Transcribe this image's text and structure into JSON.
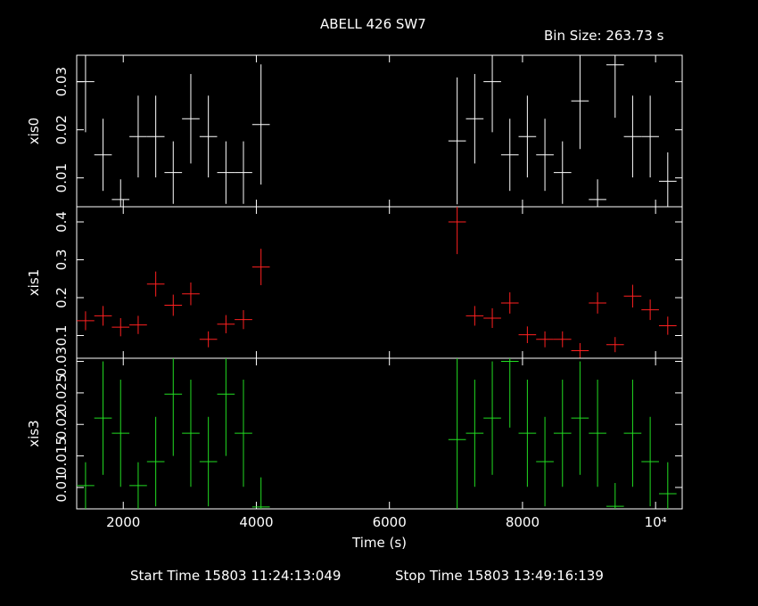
{
  "title": "ABELL 426 SW7",
  "bin_size": "Bin Size: 263.73 s",
  "start_time": "Start Time 15803 11:24:13:049",
  "stop_time": "Stop Time 15803 13:49:16:139",
  "chart_data": {
    "type": "scatter",
    "xlabel": "Time (s)",
    "xlim": [
      1300,
      10400
    ],
    "x_ticks": [
      {
        "v": 2000,
        "label": "2000"
      },
      {
        "v": 4000,
        "label": "4000"
      },
      {
        "v": 6000,
        "label": "6000"
      },
      {
        "v": 8000,
        "label": "8000"
      },
      {
        "v": 10000,
        "label": "10⁴"
      }
    ],
    "bin_half_width": 131.87,
    "panels": [
      {
        "name": "xis0",
        "ylabel": "xis0",
        "color": "#ffffff",
        "ylim": [
          0.004,
          0.0355
        ],
        "ticks": [
          {
            "v": 0.01,
            "label": "0.01"
          },
          {
            "v": 0.02,
            "label": "0.02"
          },
          {
            "v": 0.03,
            "label": "0.03"
          }
        ],
        "points": [
          {
            "x": 1433,
            "y": 0.03,
            "err": 0.0105
          },
          {
            "x": 1696,
            "y": 0.0148,
            "err": 0.0075
          },
          {
            "x": 1960,
            "y": 0.0055,
            "err": 0.0042
          },
          {
            "x": 2224,
            "y": 0.0186,
            "err": 0.0085
          },
          {
            "x": 2488,
            "y": 0.0186,
            "err": 0.0085
          },
          {
            "x": 2751,
            "y": 0.0111,
            "err": 0.0065
          },
          {
            "x": 3015,
            "y": 0.0223,
            "err": 0.0093
          },
          {
            "x": 3279,
            "y": 0.0186,
            "err": 0.0085
          },
          {
            "x": 3543,
            "y": 0.0111,
            "err": 0.0065
          },
          {
            "x": 3806,
            "y": 0.0111,
            "err": 0.0065
          },
          {
            "x": 4070,
            "y": 0.0211,
            "err": 0.0125
          },
          {
            "x": 7018,
            "y": 0.0177,
            "err": 0.0132
          },
          {
            "x": 7282,
            "y": 0.0223,
            "err": 0.0093
          },
          {
            "x": 7546,
            "y": 0.03,
            "err": 0.0105
          },
          {
            "x": 7810,
            "y": 0.0148,
            "err": 0.0075
          },
          {
            "x": 8073,
            "y": 0.0186,
            "err": 0.0085
          },
          {
            "x": 8337,
            "y": 0.0148,
            "err": 0.0075
          },
          {
            "x": 8601,
            "y": 0.0111,
            "err": 0.0065
          },
          {
            "x": 8864,
            "y": 0.026,
            "err": 0.01
          },
          {
            "x": 9128,
            "y": 0.0055,
            "err": 0.0042
          },
          {
            "x": 9392,
            "y": 0.0335,
            "err": 0.011
          },
          {
            "x": 9655,
            "y": 0.0186,
            "err": 0.0085
          },
          {
            "x": 9919,
            "y": 0.0186,
            "err": 0.0085
          },
          {
            "x": 10183,
            "y": 0.0093,
            "err": 0.006
          }
        ]
      },
      {
        "name": "xis1",
        "ylabel": "xis1",
        "color": "#ff2020",
        "ylim": [
          0.04,
          0.44
        ],
        "ticks": [
          {
            "v": 0.1,
            "label": "0.1"
          },
          {
            "v": 0.2,
            "label": "0.2"
          },
          {
            "v": 0.3,
            "label": "0.3"
          },
          {
            "v": 0.4,
            "label": "0.4"
          }
        ],
        "points": [
          {
            "x": 1433,
            "y": 0.139,
            "err": 0.025
          },
          {
            "x": 1696,
            "y": 0.152,
            "err": 0.026
          },
          {
            "x": 1960,
            "y": 0.122,
            "err": 0.024
          },
          {
            "x": 2224,
            "y": 0.128,
            "err": 0.024
          },
          {
            "x": 2488,
            "y": 0.236,
            "err": 0.033
          },
          {
            "x": 2751,
            "y": 0.18,
            "err": 0.028
          },
          {
            "x": 3015,
            "y": 0.21,
            "err": 0.03
          },
          {
            "x": 3279,
            "y": 0.09,
            "err": 0.021
          },
          {
            "x": 3543,
            "y": 0.13,
            "err": 0.024
          },
          {
            "x": 3806,
            "y": 0.142,
            "err": 0.025
          },
          {
            "x": 4070,
            "y": 0.281,
            "err": 0.048
          },
          {
            "x": 7018,
            "y": 0.4,
            "err": 0.085
          },
          {
            "x": 7282,
            "y": 0.152,
            "err": 0.026
          },
          {
            "x": 7546,
            "y": 0.146,
            "err": 0.026
          },
          {
            "x": 7810,
            "y": 0.186,
            "err": 0.028
          },
          {
            "x": 8073,
            "y": 0.102,
            "err": 0.022
          },
          {
            "x": 8337,
            "y": 0.09,
            "err": 0.021
          },
          {
            "x": 8601,
            "y": 0.09,
            "err": 0.021
          },
          {
            "x": 8864,
            "y": 0.06,
            "err": 0.02
          },
          {
            "x": 9128,
            "y": 0.186,
            "err": 0.028
          },
          {
            "x": 9392,
            "y": 0.076,
            "err": 0.02
          },
          {
            "x": 9655,
            "y": 0.204,
            "err": 0.03
          },
          {
            "x": 9919,
            "y": 0.168,
            "err": 0.027
          },
          {
            "x": 10183,
            "y": 0.126,
            "err": 0.024
          }
        ]
      },
      {
        "name": "xis3",
        "ylabel": "xis3",
        "color": "#22dd22",
        "ylim": [
          0.0066,
          0.0305
        ],
        "ticks": [
          {
            "v": 0.01,
            "label": "0.01"
          },
          {
            "v": 0.015,
            "label": "0.015"
          },
          {
            "v": 0.02,
            "label": "0.02"
          },
          {
            "v": 0.025,
            "label": "0.025"
          },
          {
            "v": 0.03,
            "label": "0.03"
          }
        ],
        "points": [
          {
            "x": 1433,
            "y": 0.0103,
            "err": 0.0037
          },
          {
            "x": 1696,
            "y": 0.021,
            "err": 0.009
          },
          {
            "x": 1960,
            "y": 0.0186,
            "err": 0.0085
          },
          {
            "x": 2224,
            "y": 0.0103,
            "err": 0.0037
          },
          {
            "x": 2488,
            "y": 0.0141,
            "err": 0.0071
          },
          {
            "x": 2751,
            "y": 0.0248,
            "err": 0.0098
          },
          {
            "x": 3015,
            "y": 0.0186,
            "err": 0.0085
          },
          {
            "x": 3279,
            "y": 0.0141,
            "err": 0.0071
          },
          {
            "x": 3543,
            "y": 0.0248,
            "err": 0.0098
          },
          {
            "x": 3806,
            "y": 0.0186,
            "err": 0.0085
          },
          {
            "x": 4070,
            "y": 0.0069,
            "err": 0.0047
          },
          {
            "x": 7018,
            "y": 0.0176,
            "err": 0.0136
          },
          {
            "x": 7282,
            "y": 0.0186,
            "err": 0.0085
          },
          {
            "x": 7546,
            "y": 0.021,
            "err": 0.009
          },
          {
            "x": 7810,
            "y": 0.03,
            "err": 0.0105
          },
          {
            "x": 8073,
            "y": 0.0186,
            "err": 0.0085
          },
          {
            "x": 8337,
            "y": 0.0141,
            "err": 0.0071
          },
          {
            "x": 8601,
            "y": 0.0186,
            "err": 0.0085
          },
          {
            "x": 8864,
            "y": 0.021,
            "err": 0.009
          },
          {
            "x": 9128,
            "y": 0.0186,
            "err": 0.0085
          },
          {
            "x": 9392,
            "y": 0.007,
            "err": 0.0037
          },
          {
            "x": 9655,
            "y": 0.0186,
            "err": 0.0085
          },
          {
            "x": 9919,
            "y": 0.0141,
            "err": 0.0071
          },
          {
            "x": 10183,
            "y": 0.009,
            "err": 0.005
          }
        ]
      }
    ]
  }
}
